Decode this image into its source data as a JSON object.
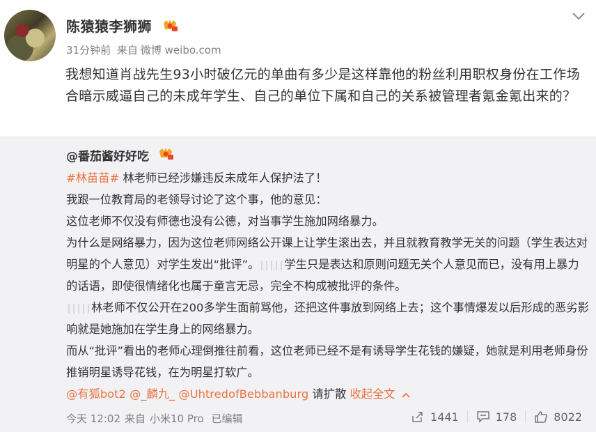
{
  "post": {
    "username": "陈猿猿李狮狮",
    "meta": {
      "time": "31分钟前",
      "source_prefix": "来自",
      "source": "微博 weibo.com"
    },
    "text": "我想知道肖战先生93小时破亿元的单曲有多少是这样靠他的粉丝利用职权身份在工作场合暗示威逼自己的未成年学生、自己的单位下属和自己的关系被管理者氪金氪出来的？"
  },
  "quoted": {
    "author": "@番茄酱好好吃",
    "hashtag": "#林苗苗#",
    "line1_rest": " 林老师已经涉嫌违反未成年人保护法了！",
    "line2": "我跟一位教育局的老领导讨论了这个事，他的意见：",
    "line3": "这位老师不仅没有师德也没有公德，对当事学生施加网络暴力。",
    "line4a": "为什么是网络暴力，因为这位老师网络公开课上让学生滚出去，并且就教育教学无关的问题（学生表达对明星的个人意见）对学生发出“批评”。",
    "line4b": "学生只是表达和原则问题无关个人意见而已，没有用上暴力的话语，即使很情绪化也属于童言无忌，完全不构成被批评的条件。",
    "line5": "林老师不仅公开在200多学生面前骂他，还把这件事放到网络上去；这个事情爆发以后形成的恶劣影响就是她施加在学生身上的网络暴力。",
    "line6": "而从“批评”看出的老师心理倒推往前看，这位老师已经不是有诱导学生花钱的嫌疑，她就是利用老师身份推销明星诱导花钱，在为明星打软广。",
    "mentions": [
      "@有狐bot2",
      "@_麟九_",
      "@UhtredofBebbanburg"
    ],
    "mentions_suffix": " 请扩散 ",
    "collapse_label": "收起全文",
    "footer": {
      "time": "今天 12:02",
      "source_prefix": "来自",
      "device": "小米10 Pro",
      "edited": "已编辑"
    },
    "actions": {
      "repost_count": "1441",
      "comment_count": "178",
      "like_count": "8022"
    }
  },
  "colors": {
    "link": "#eb7340",
    "meta": "#808080",
    "quote_bg": "#f2f2f5"
  }
}
